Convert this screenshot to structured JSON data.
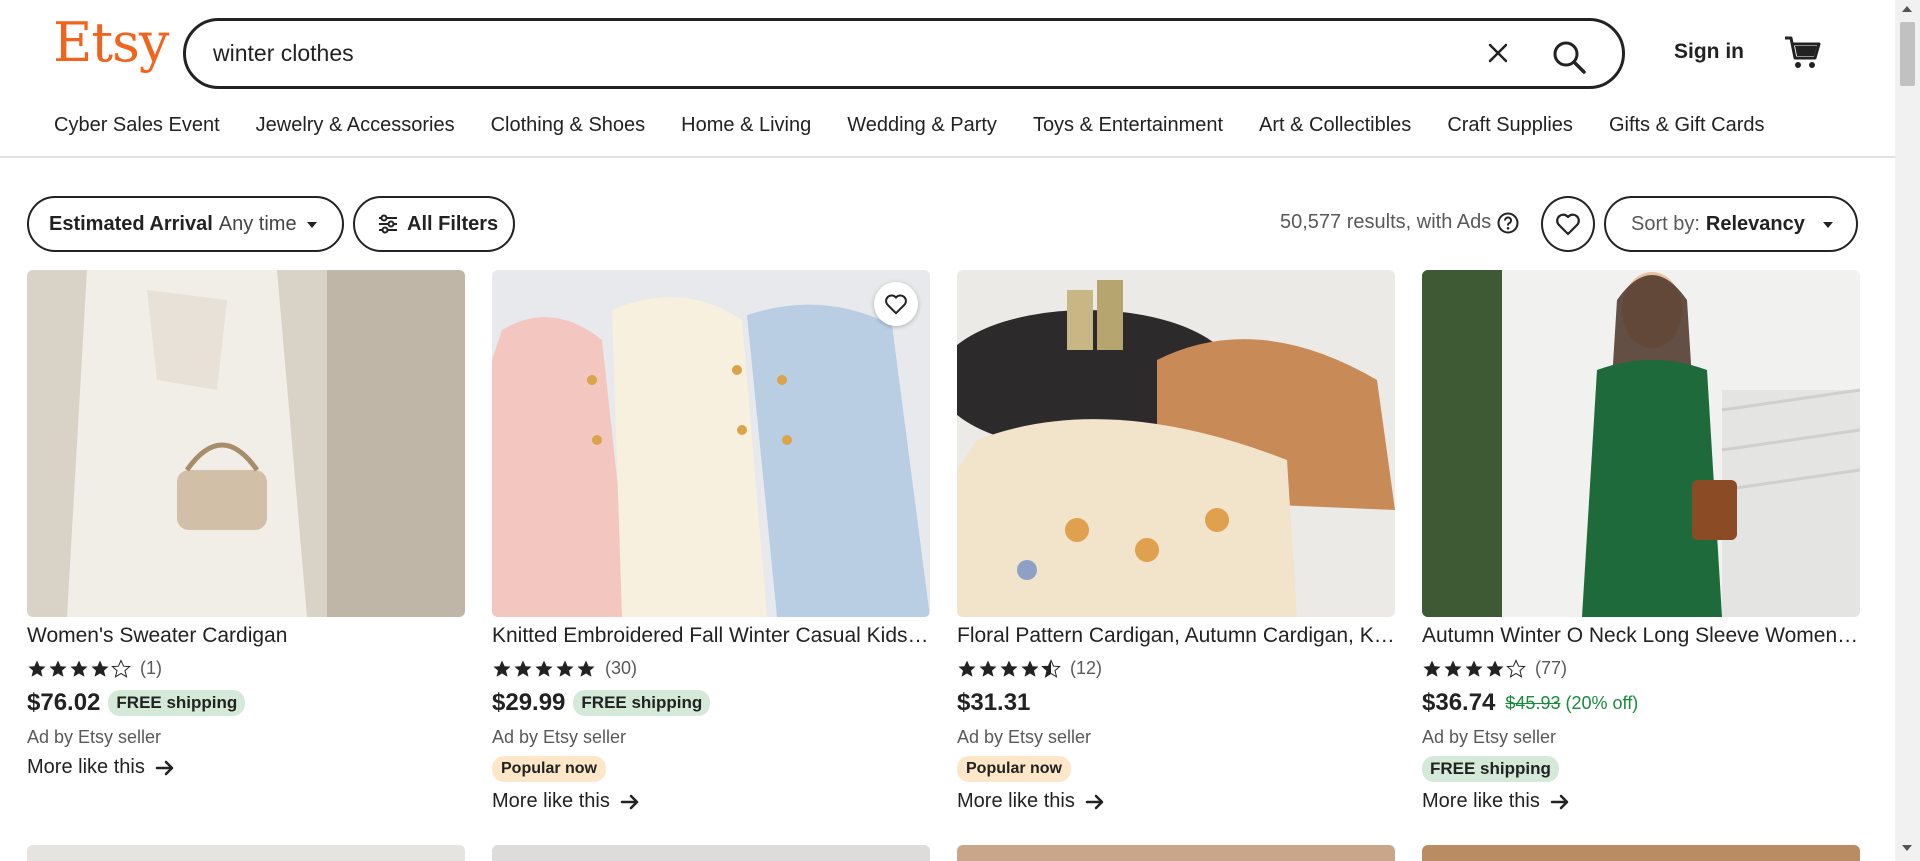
{
  "brand": {
    "logo": "Etsy",
    "color": "#F1641E"
  },
  "search": {
    "value": "winter clothes",
    "clear_icon": "close-icon",
    "search_icon": "search-icon"
  },
  "header": {
    "signin": "Sign in",
    "cart_icon": "cart-icon"
  },
  "categories": [
    "Cyber Sales Event",
    "Jewelry & Accessories",
    "Clothing & Shoes",
    "Home & Living",
    "Wedding & Party",
    "Toys & Entertainment",
    "Art & Collectibles",
    "Craft Supplies",
    "Gifts & Gift Cards"
  ],
  "filters": {
    "arrival_label": "Estimated Arrival",
    "arrival_value": "Any time",
    "all_filters": "All Filters",
    "results": "50,577 results, with Ads",
    "sort_label": "Sort by:",
    "sort_value": "Relevancy"
  },
  "listings": [
    {
      "title": "Women's Sweater Cardigan",
      "rating": 4,
      "reviews": "(1)",
      "price": "$76.02",
      "original_price": "",
      "discount": "",
      "free_shipping": "FREE shipping",
      "ad": "Ad by Etsy seller",
      "popular": "",
      "more": "More like this"
    },
    {
      "title": "Knitted Embroidered Fall Winter Casual Kids Cardigan",
      "rating": 5,
      "reviews": "(30)",
      "price": "$29.99",
      "original_price": "",
      "discount": "",
      "free_shipping": "FREE shipping",
      "ad": "Ad by Etsy seller",
      "popular": "Popular now",
      "more": "More like this"
    },
    {
      "title": "Floral Pattern Cardigan, Autumn Cardigan, Knit Sweater",
      "rating": 4.5,
      "reviews": "(12)",
      "price": "$31.31",
      "original_price": "",
      "discount": "",
      "free_shipping": "",
      "ad": "Ad by Etsy seller",
      "popular": "Popular now",
      "more": "More like this"
    },
    {
      "title": "Autumn Winter O Neck Long Sleeve Women Dress",
      "rating": 4,
      "reviews": "(77)",
      "price": "$36.74",
      "original_price": "$45.93",
      "discount": "(20% off)",
      "free_shipping": "FREE shipping",
      "ad": "Ad by Etsy seller",
      "popular": "",
      "more": "More like this"
    }
  ]
}
